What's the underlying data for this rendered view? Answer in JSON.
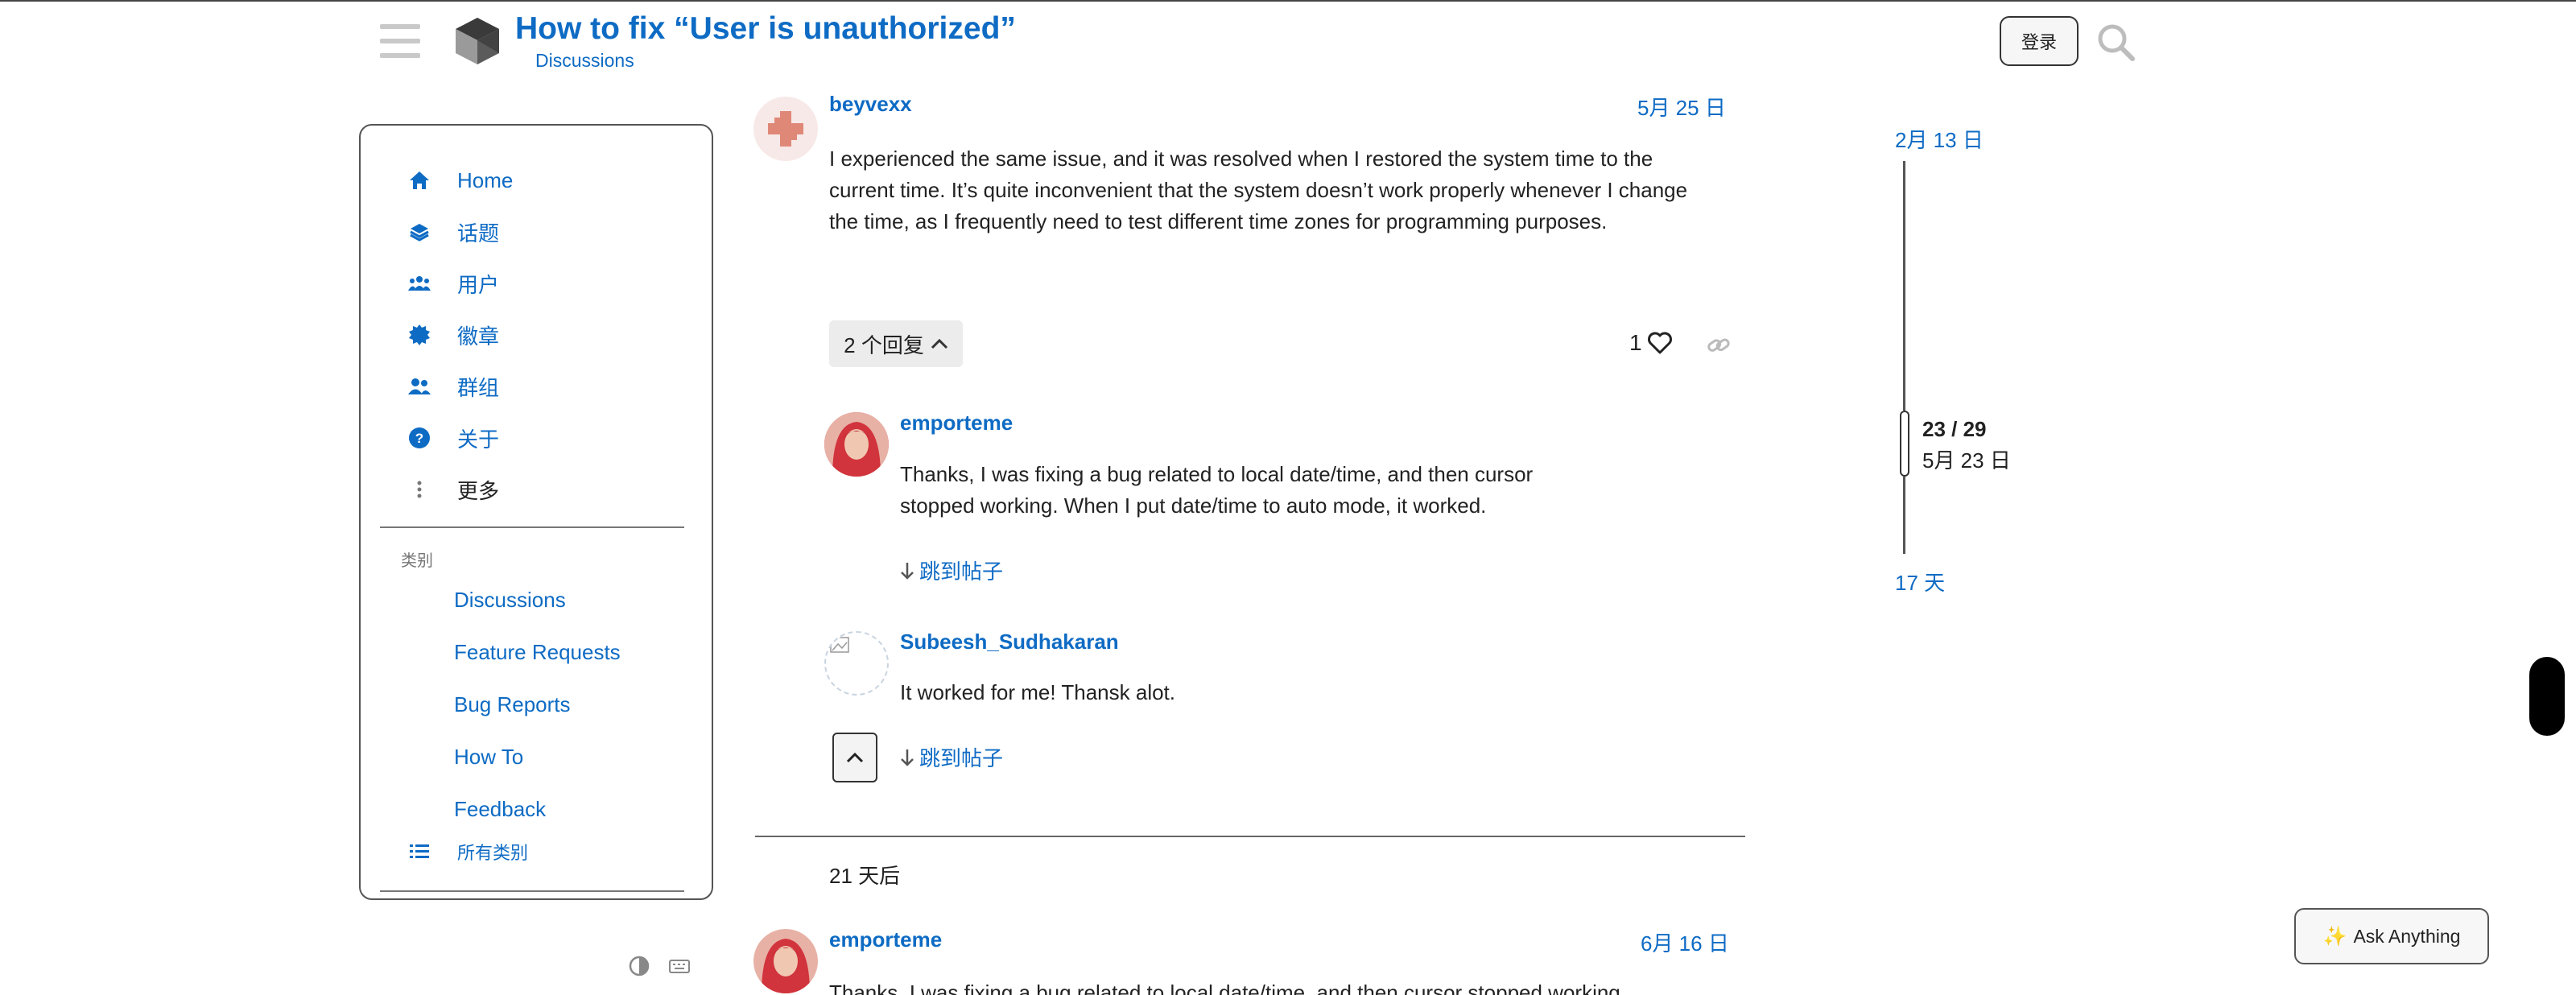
{
  "header": {
    "title": "How to fix “User is unauthorized”",
    "category": "Discussions",
    "login_label": "登录"
  },
  "sidebar": {
    "nav": [
      {
        "label": "Home",
        "icon": "home-icon"
      },
      {
        "label": "话题",
        "icon": "layers-icon"
      },
      {
        "label": "用户",
        "icon": "users-icon"
      },
      {
        "label": "徽章",
        "icon": "badge-icon"
      },
      {
        "label": "群组",
        "icon": "group-icon"
      },
      {
        "label": "关于",
        "icon": "question-icon"
      },
      {
        "label": "更多",
        "icon": "more-vertical-icon"
      }
    ],
    "categories_label": "类别",
    "categories": [
      "Discussions",
      "Feature Requests",
      "Bug Reports",
      "How To",
      "Feedback"
    ],
    "all_categories": "所有类别"
  },
  "post_main": {
    "username": "beyvexx",
    "date": "5月 25 日",
    "text": "I experienced the same issue, and it was resolved when I restored the system time to the current time. It’s quite inconvenient that the system doesn’t work properly whenever I change the time, as I frequently need to test different time zones for programming purposes.",
    "replies_label": "2 个回复",
    "likes": "1"
  },
  "replies": [
    {
      "username": "emporteme",
      "text_line1": "Thanks, I was fixing a bug related to local date/time, and then cursor",
      "text_line2": "stopped working. When I put date/time to auto mode, it worked.",
      "jump_label": "跳到帖子"
    },
    {
      "username": "Subeesh_Sudhakaran",
      "text": "It worked for me! Thansk alot.",
      "jump_label": "跳到帖子"
    }
  ],
  "gap_label": "21 天后",
  "post_next": {
    "username": "emporteme",
    "date": "6月 16 日",
    "text_partial": "Thanks, I was fixing a bug related to local date/time, and then cursor stopped working"
  },
  "timeline": {
    "start_date": "2月 13 日",
    "position": "23 / 29",
    "current_date": "5月 23 日",
    "end_label": "17 天"
  },
  "ask_button": {
    "icon": "sparkle-icon",
    "label": "Ask Anything"
  },
  "colors": {
    "link": "#0e6bc4",
    "text": "#222222"
  }
}
